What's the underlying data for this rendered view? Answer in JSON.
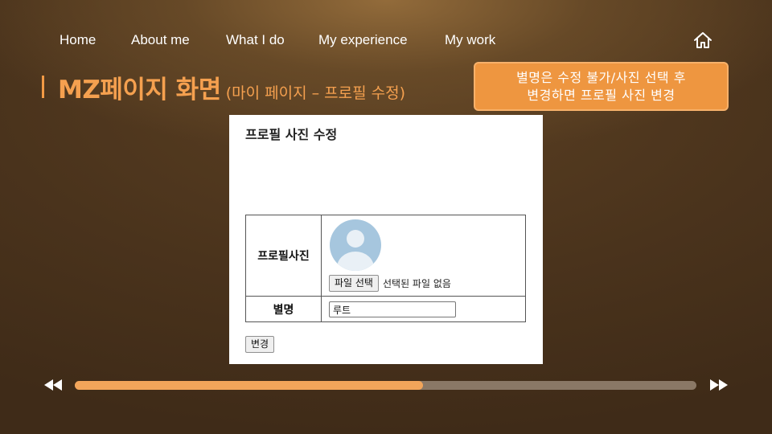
{
  "nav": {
    "items": [
      "Home",
      "About me",
      "What I do",
      "My experience",
      "My work"
    ]
  },
  "title": {
    "main": "MZ페이지 화면",
    "sub": "(마이 페이지 – 프로필 수정)"
  },
  "callout": {
    "line1": "별명은 수정 불가/사진 선택 후",
    "line2": "변경하면 프로필 사진 변경"
  },
  "form": {
    "heading": "프로필 사진 수정",
    "photo_label": "프로필사진",
    "file_button": "파일 선택",
    "file_status": "선택된 파일 없음",
    "nickname_label": "별명",
    "nickname_value": "루트",
    "change_button": "변경"
  },
  "player": {
    "progress": 0.56
  },
  "colors": {
    "accent": "#f5a04f",
    "callout_bg": "#ee9640",
    "progress_fill": "#f2a55a",
    "progress_track": "#8a7866"
  },
  "icons": {
    "home": "home-icon",
    "rewind": "rewind-icon",
    "forward": "fast-forward-icon"
  }
}
